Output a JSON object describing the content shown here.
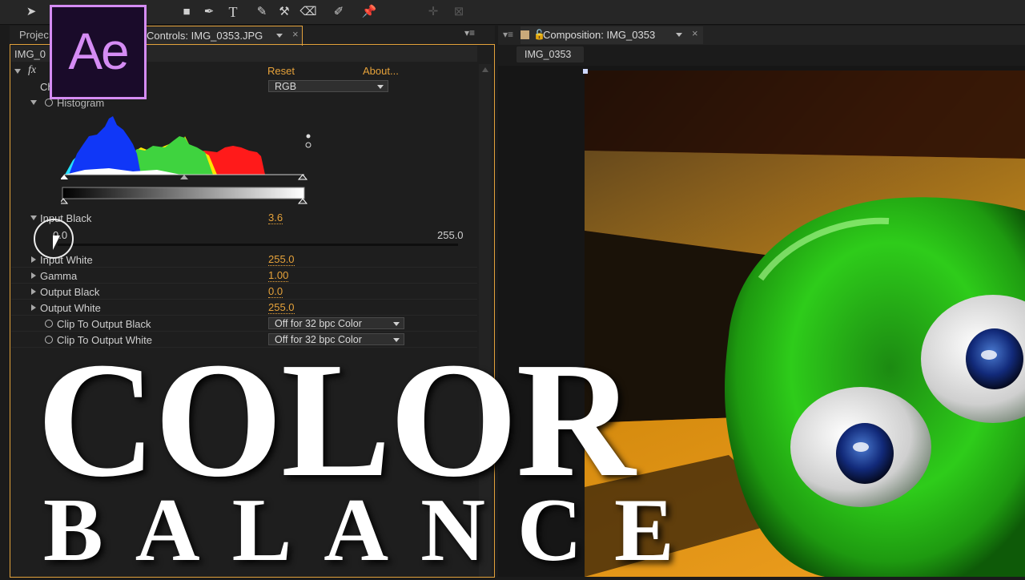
{
  "app": {
    "logo_text": "Ae",
    "accent_color": "#e6a23a",
    "logo_color": "#d58cf4"
  },
  "toolbar": {
    "tools": [
      "selection-tool",
      "hand-tool",
      "zoom-tool",
      "rotate-tool",
      "camera-tool",
      "pan-behind-tool",
      "rectangle-tool",
      "pen-tool",
      "type-tool",
      "brush-tool",
      "clone-stamp-tool",
      "eraser-tool",
      "roto-brush-tool",
      "puppet-pin-tool"
    ]
  },
  "left_panel": {
    "project_tab": "Projec",
    "effect_tab": "Controls: IMG_0353.JPG",
    "layer_label": "IMG_0",
    "reset_label": "Reset",
    "about_label": "About...",
    "channel_label": "Ch",
    "channel_value": "RGB",
    "histogram_label": "Histogram",
    "input_black": {
      "label": "Input Black",
      "value": "3.6",
      "slider_min": "0.0",
      "slider_max": "255.0"
    },
    "properties": [
      {
        "label": "Input White",
        "value": "255.0"
      },
      {
        "label": "Gamma",
        "value": "1.00"
      },
      {
        "label": "Output Black",
        "value": "0.0"
      },
      {
        "label": "Output White",
        "value": "255.0"
      }
    ],
    "clip_black": {
      "label": "Clip To Output Black",
      "value": "Off for 32 bpc Color"
    },
    "clip_white": {
      "label": "Clip To Output White",
      "value": "Off for 32 bpc Color"
    }
  },
  "right_panel": {
    "composition_tab": "Composition: IMG_0353",
    "comp_subtab": "IMG_0353"
  },
  "headline": {
    "line1": "COLOR",
    "line2": "BALANCE"
  }
}
